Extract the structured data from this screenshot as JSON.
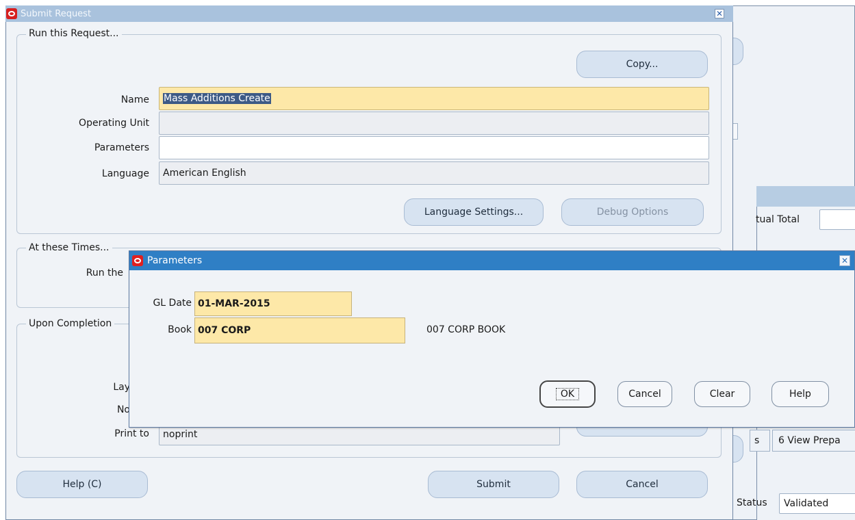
{
  "bg_window": {
    "actual_total_label": "tual Total",
    "tab_partial": "s",
    "tab_view_prepa": "6 View Prepa",
    "status_label": "Status",
    "status_value": "Validated"
  },
  "submit_window": {
    "title": "Submit Request",
    "run_group_label": "Run this Request...",
    "copy_button": "Copy...",
    "name_label": "Name",
    "name_value": "Mass Additions Create",
    "operating_unit_label": "Operating Unit",
    "operating_unit_value": "",
    "parameters_label": "Parameters",
    "parameters_value": "",
    "language_label": "Language",
    "language_value": "American English",
    "language_settings_button": "Language Settings...",
    "debug_options_button": "Debug Options",
    "times_group_label": "At these Times...",
    "run_the_label": "Run the",
    "completion_group_label": "Upon Completion",
    "layout_label_partial": "Lay",
    "notify_label_partial": "No",
    "print_to_label": "Print to",
    "print_to_value": "noprint",
    "help_button": "Help (C)",
    "submit_button": "Submit",
    "cancel_button": "Cancel"
  },
  "parameters_dialog": {
    "title": "Parameters",
    "gl_date_label": "GL Date",
    "gl_date_value": "01-MAR-2015",
    "book_label": "Book",
    "book_value": "007 CORP",
    "book_description": "007 CORP BOOK",
    "ok_button": "OK",
    "cancel_button": "Cancel",
    "clear_button": "Clear",
    "help_button": "Help"
  },
  "colors": {
    "required_field": "#fde8a8",
    "dialog_title_bar": "#2f7fc5",
    "window_title_bar": "#a9c2dd",
    "oracle_red": "#d71f1f"
  }
}
